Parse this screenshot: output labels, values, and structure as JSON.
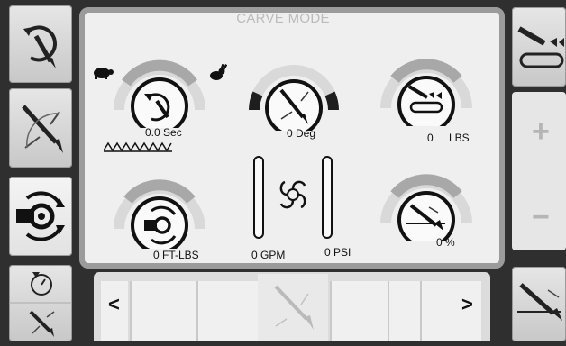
{
  "panel": {
    "title": "CARVE MODE"
  },
  "gauges": [
    {
      "id": "carve-time",
      "value_label": "0.0 Sec"
    },
    {
      "id": "carve-angle",
      "value_label": "0 Deg"
    },
    {
      "id": "pressure-weight",
      "value_label": "0",
      "unit_label": "LBS"
    },
    {
      "id": "torque",
      "value_label": "0 FT-LBS"
    },
    {
      "id": "flow",
      "value_label": "0 GPM"
    },
    {
      "id": "pressure",
      "value_label": "0 PSI"
    },
    {
      "id": "percent",
      "value_label": "0 %"
    }
  ],
  "rail": {
    "plus_label": "+",
    "minus_label": "−"
  },
  "nav": {
    "prev_label": "<",
    "next_label": ">"
  },
  "colors": {
    "background": "#2f2f2f",
    "panel_border": "#9b9b9b",
    "gauge_arc_light": "#dcdcdc",
    "gauge_arc_dark": "#8a8a8a",
    "gauge_arc_black": "#1e1e1e"
  },
  "icons": {
    "left_rail": [
      "rotate-carve-icon",
      "carve-angle-icon",
      "torque-rotate-icon",
      "timer-carve-icon"
    ],
    "right_rail": [
      "weight-sled-icon",
      "blade-angle-icon"
    ]
  }
}
